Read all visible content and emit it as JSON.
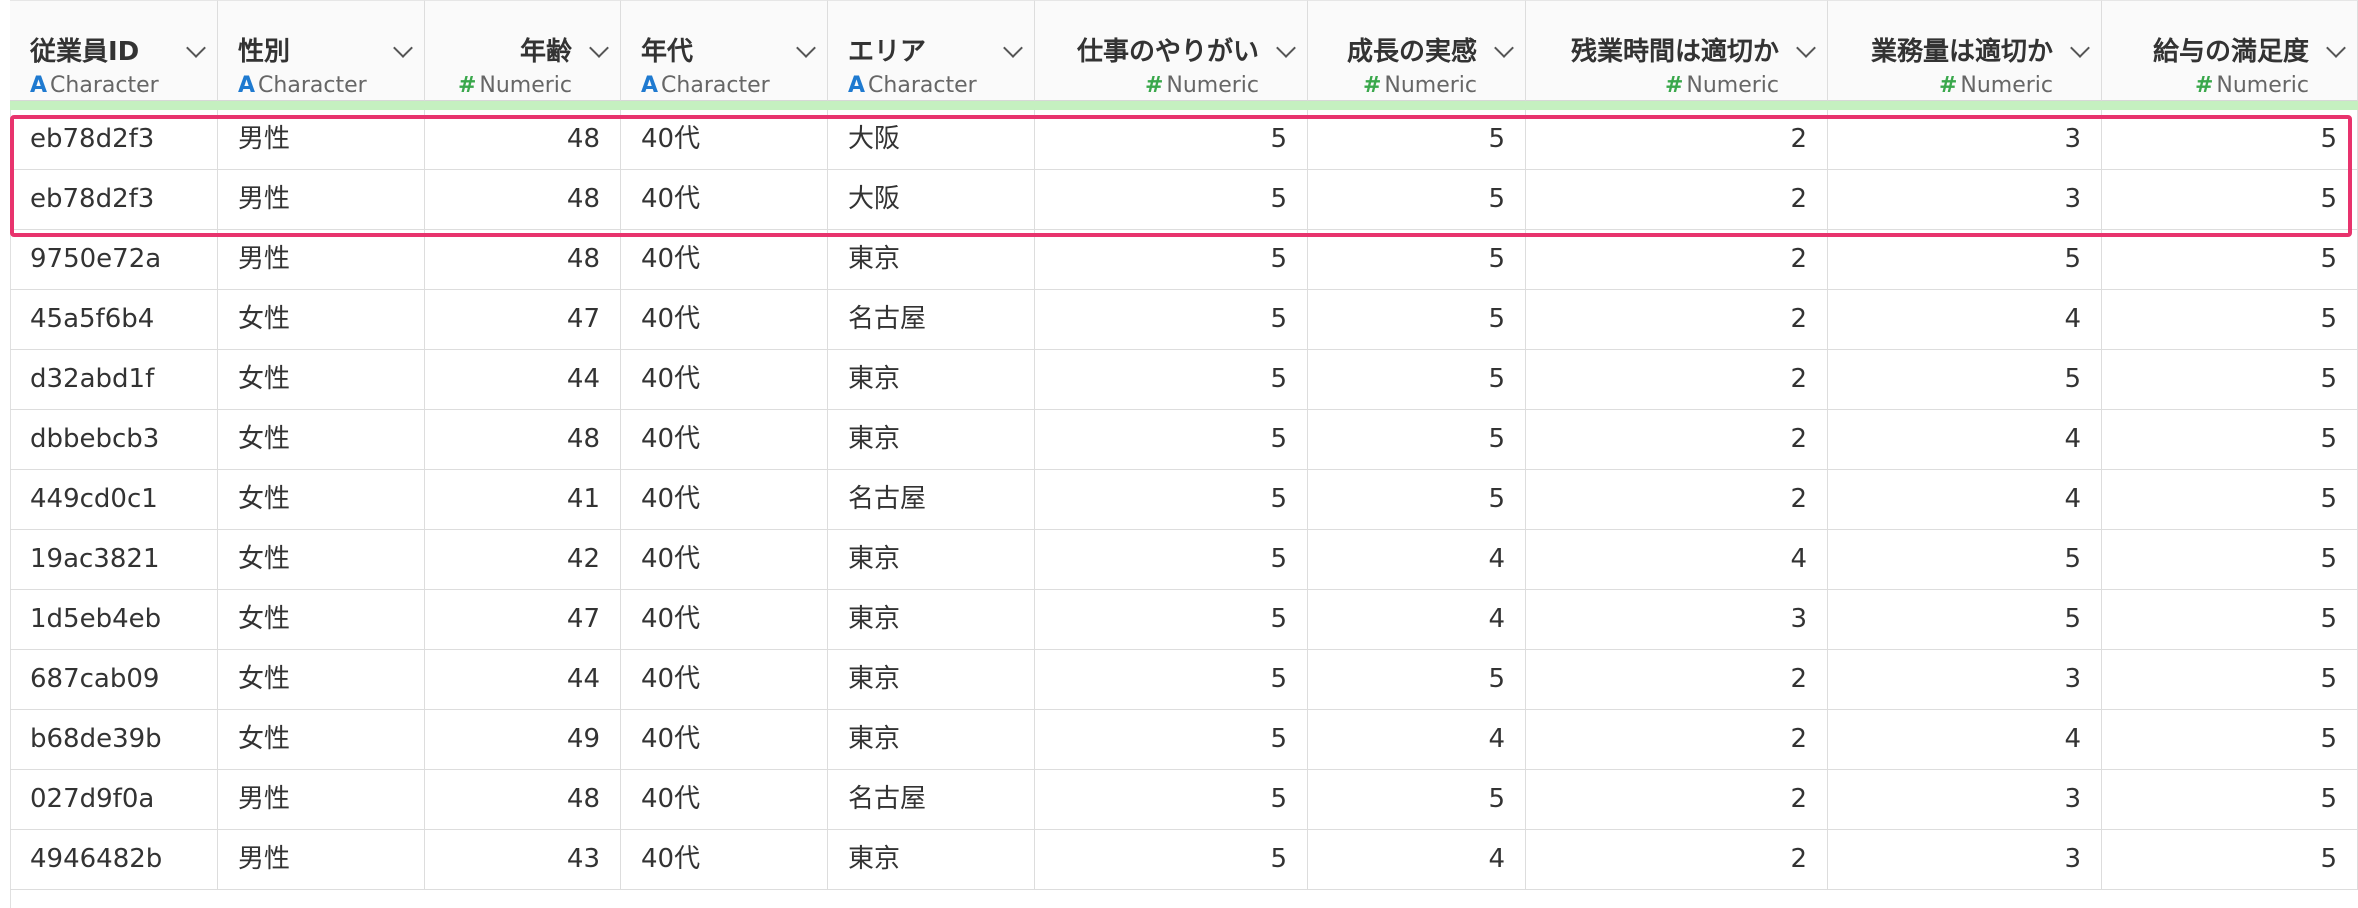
{
  "columns": [
    {
      "title": "従業員ID",
      "type": "Character",
      "glyph": "A",
      "align": "left"
    },
    {
      "title": "性別",
      "type": "Character",
      "glyph": "A",
      "align": "left"
    },
    {
      "title": "年齢",
      "type": "Numeric",
      "glyph": "#",
      "align": "right"
    },
    {
      "title": "年代",
      "type": "Character",
      "glyph": "A",
      "align": "left"
    },
    {
      "title": "エリア",
      "type": "Character",
      "glyph": "A",
      "align": "left"
    },
    {
      "title": "仕事のやりがい",
      "type": "Numeric",
      "glyph": "#",
      "align": "right"
    },
    {
      "title": "成長の実感",
      "type": "Numeric",
      "glyph": "#",
      "align": "right"
    },
    {
      "title": "残業時間は適切か",
      "type": "Numeric",
      "glyph": "#",
      "align": "right"
    },
    {
      "title": "業務量は適切か",
      "type": "Numeric",
      "glyph": "#",
      "align": "right"
    },
    {
      "title": "給与の満足度",
      "type": "Numeric",
      "glyph": "#",
      "align": "right"
    }
  ],
  "rows": [
    [
      "eb78d2f3",
      "男性",
      "48",
      "40代",
      "大阪",
      "5",
      "5",
      "2",
      "3",
      "5"
    ],
    [
      "eb78d2f3",
      "男性",
      "48",
      "40代",
      "大阪",
      "5",
      "5",
      "2",
      "3",
      "5"
    ],
    [
      "9750e72a",
      "男性",
      "48",
      "40代",
      "東京",
      "5",
      "5",
      "2",
      "5",
      "5"
    ],
    [
      "45a5f6b4",
      "女性",
      "47",
      "40代",
      "名古屋",
      "5",
      "5",
      "2",
      "4",
      "5"
    ],
    [
      "d32abd1f",
      "女性",
      "44",
      "40代",
      "東京",
      "5",
      "5",
      "2",
      "5",
      "5"
    ],
    [
      "dbbebcb3",
      "女性",
      "48",
      "40代",
      "東京",
      "5",
      "5",
      "2",
      "4",
      "5"
    ],
    [
      "449cd0c1",
      "女性",
      "41",
      "40代",
      "名古屋",
      "5",
      "5",
      "2",
      "4",
      "5"
    ],
    [
      "19ac3821",
      "女性",
      "42",
      "40代",
      "東京",
      "5",
      "4",
      "4",
      "5",
      "5"
    ],
    [
      "1d5eb4eb",
      "女性",
      "47",
      "40代",
      "東京",
      "5",
      "4",
      "3",
      "5",
      "5"
    ],
    [
      "687cab09",
      "女性",
      "44",
      "40代",
      "東京",
      "5",
      "5",
      "2",
      "3",
      "5"
    ],
    [
      "b68de39b",
      "女性",
      "49",
      "40代",
      "東京",
      "5",
      "4",
      "2",
      "4",
      "5"
    ],
    [
      "027d9f0a",
      "男性",
      "48",
      "40代",
      "名古屋",
      "5",
      "5",
      "2",
      "3",
      "5"
    ],
    [
      "4946482b",
      "男性",
      "43",
      "40代",
      "東京",
      "5",
      "4",
      "2",
      "3",
      "5"
    ]
  ],
  "colors": {
    "highlight": "#e8336d",
    "character_type": "#1f7ad0",
    "numeric_type": "#3aa84c",
    "header_underline": "#c5f0c0"
  },
  "icons": {
    "header_menu": "chevron-down-icon",
    "character_type": "character-type-icon",
    "numeric_type": "numeric-type-icon"
  }
}
